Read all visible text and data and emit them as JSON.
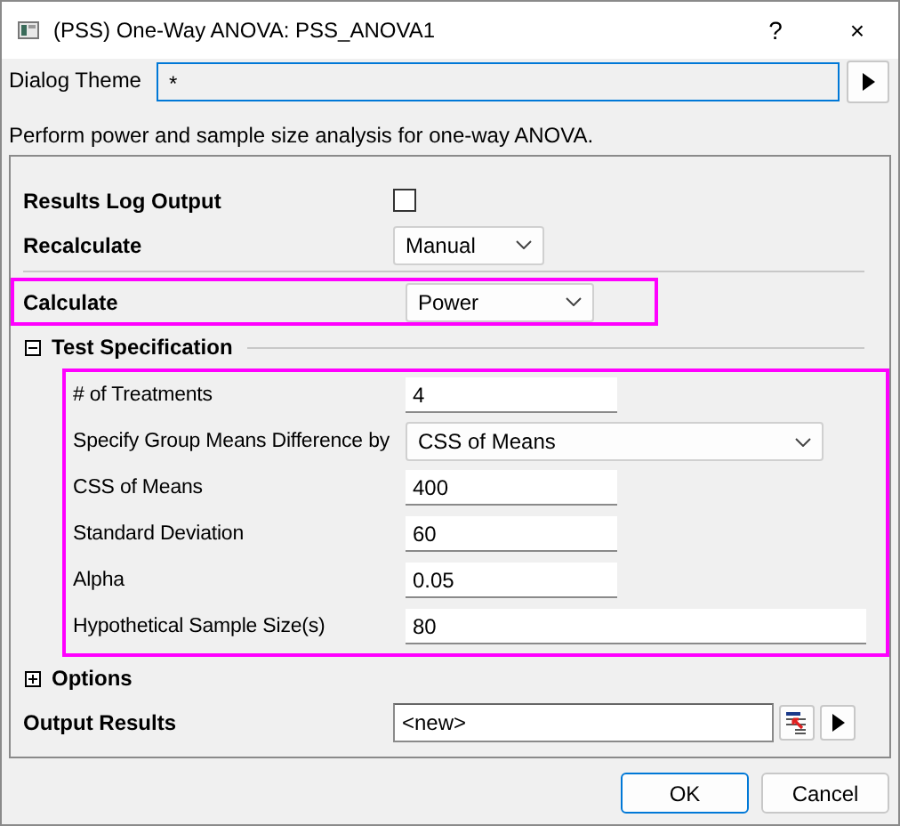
{
  "window": {
    "title": "(PSS) One-Way ANOVA: PSS_ANOVA1",
    "title_buttons": [
      "?",
      "×"
    ]
  },
  "dialog_theme": {
    "label": "Dialog Theme",
    "value": "*"
  },
  "description": "Perform power and sample size analysis for one-way ANOVA.",
  "settings": [
    {
      "kind": "checkbox",
      "label": "Results Log Output",
      "checked": false
    },
    {
      "kind": "combo",
      "label": "Recalculate",
      "value": "Manual"
    }
  ],
  "calculate": {
    "label": "Calculate",
    "value": "Power",
    "highlighted": true
  },
  "test_specification": {
    "label": "Test Specification",
    "expanded": true,
    "highlighted": true,
    "rows": [
      {
        "kind": "text",
        "label": "# of Treatments",
        "value": "4"
      },
      {
        "kind": "wide_combo",
        "label": "Specify Group Means Difference by",
        "value": "CSS of Means"
      },
      {
        "kind": "text",
        "label": "CSS of Means",
        "value": "400"
      },
      {
        "kind": "text",
        "label": "Standard Deviation",
        "value": "60"
      },
      {
        "kind": "text",
        "label": "Alpha",
        "value": "0.05"
      },
      {
        "kind": "wide_text",
        "label": "Hypothetical Sample Size(s)",
        "value": "80"
      }
    ]
  },
  "options": {
    "label": "Options",
    "expanded": false
  },
  "output_results": {
    "label": "Output Results",
    "value": "<new>"
  },
  "buttons": [
    {
      "label": "OK",
      "default": true
    },
    {
      "label": "Cancel",
      "default": false
    }
  ]
}
